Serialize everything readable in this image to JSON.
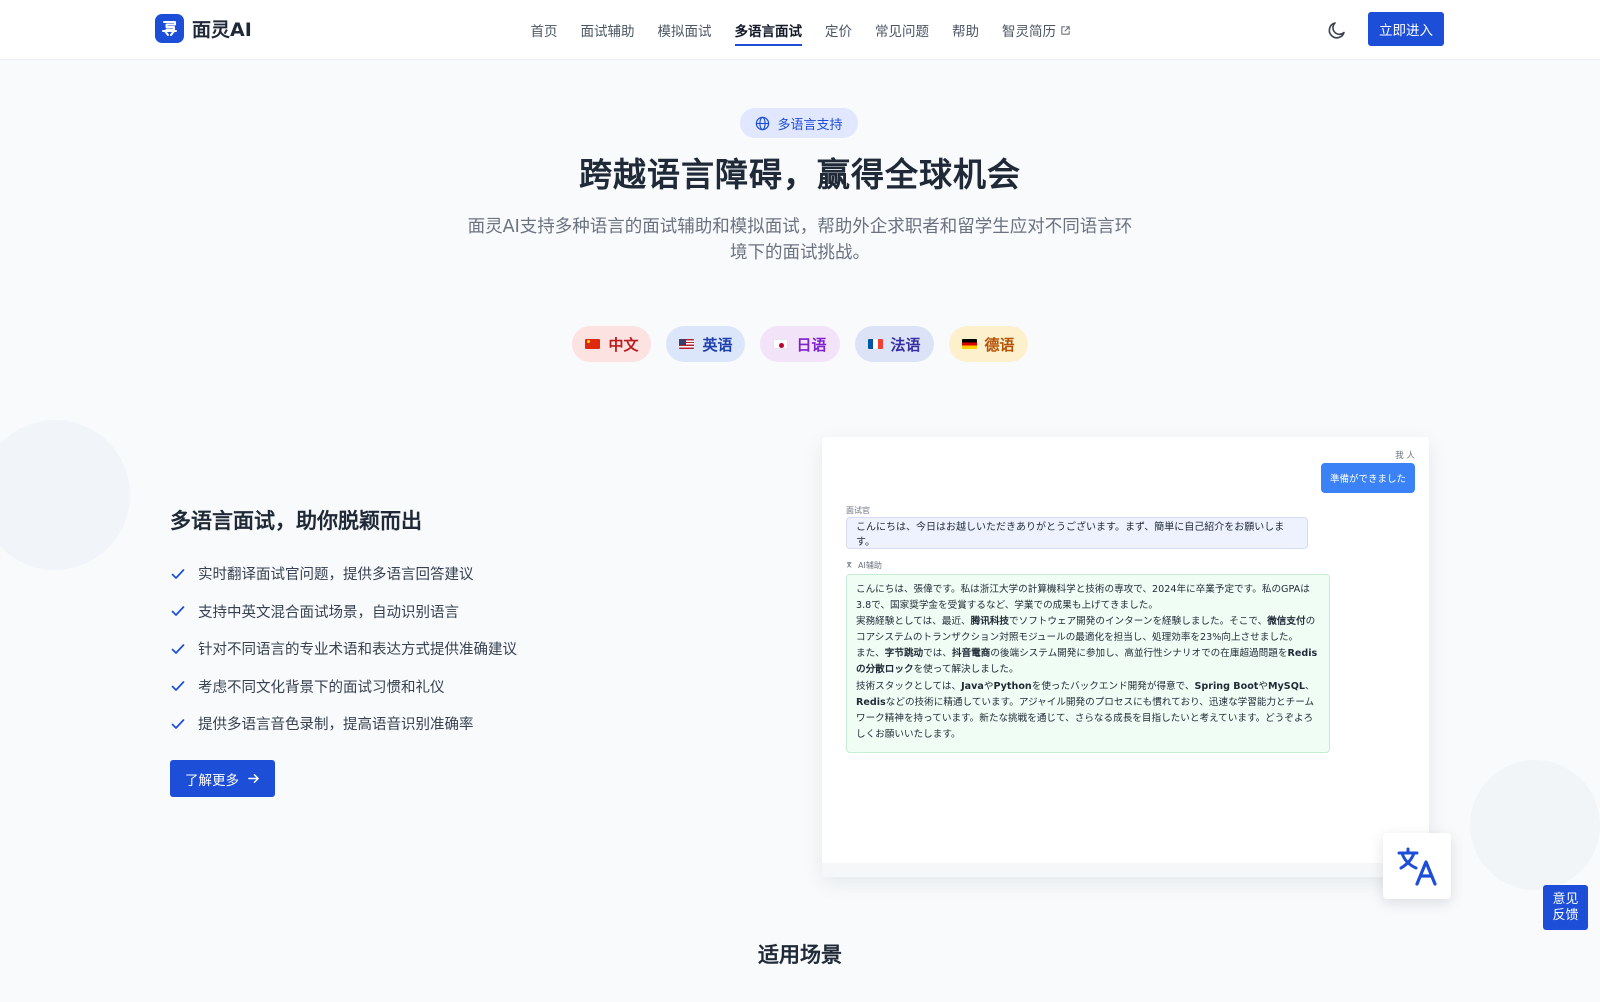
{
  "brand": {
    "name": "面灵AI"
  },
  "nav": {
    "items": [
      {
        "label": "首页",
        "active": false
      },
      {
        "label": "面试辅助",
        "active": false
      },
      {
        "label": "模拟面试",
        "active": false
      },
      {
        "label": "多语言面试",
        "active": true
      },
      {
        "label": "定价",
        "active": false
      },
      {
        "label": "常见问题",
        "active": false
      },
      {
        "label": "帮助",
        "active": false
      },
      {
        "label": "智灵简历",
        "active": false,
        "external": true
      }
    ],
    "cta_label": "立即进入",
    "theme_icon": "moon-icon"
  },
  "hero": {
    "badge": "多语言支持",
    "title": "跨越语言障碍，赢得全球机会",
    "subtitle": "面灵AI支持多种语言的面试辅助和模拟面试，帮助外企求职者和留学生应对不同语言环境下的面试挑战。"
  },
  "languages": [
    {
      "label": "中文",
      "flag": "cn-flag",
      "bg": "#fde2e2",
      "color": "#b91c1c"
    },
    {
      "label": "英语",
      "flag": "us-flag",
      "bg": "#dbe6fb",
      "color": "#1e40af"
    },
    {
      "label": "日语",
      "flag": "jp-flag",
      "bg": "#f3e3f9",
      "color": "#7e22ce"
    },
    {
      "label": "法语",
      "flag": "fr-flag",
      "bg": "#dde3f7",
      "color": "#3730a3"
    },
    {
      "label": "德语",
      "flag": "de-flag",
      "bg": "#fdf0cc",
      "color": "#b45309"
    }
  ],
  "feature": {
    "title": "多语言面试，助你脱颖而出",
    "items": [
      "实时翻译面试官问题，提供多语言回答建议",
      "支持中英文混合面试场景，自动识别语言",
      "针对不同语言的专业术语和表达方式提供准确建议",
      "考虑不同文化背景下的面试习惯和礼仪",
      "提供多语言音色录制，提高语音识别准确率"
    ],
    "button_label": "了解更多"
  },
  "chat": {
    "me_label": "我 人",
    "me_message": "準備ができました",
    "interviewer_label": "面试官",
    "interviewer_message": "こんにちは、今日はお越しいただきありがとうございます。まず、簡単に自己紹介をお願いします。",
    "ai_label": "AI辅助",
    "ai_lines": [
      [
        {
          "t": "こんにちは、張偉です。私は浙江大学の計算機科学と技術の専攻で、2024年に卒業予定です。私のGPAは3.8で、国家奨学金を受賞するなど、学業での成果も上げてきました。"
        }
      ],
      [
        {
          "t": "実務経験としては、最近、"
        },
        {
          "t": "腾讯科技",
          "b": true
        },
        {
          "t": "でソフトウェア開発のインターンを経験しました。そこで、"
        },
        {
          "t": "微信支付",
          "b": true
        },
        {
          "t": "のコアシステムのトランザクション対照モジュールの最適化を担当し、処理効率を23%向上させました。"
        }
      ],
      [
        {
          "t": "また、"
        },
        {
          "t": "字节跳动",
          "b": true
        },
        {
          "t": "では、"
        },
        {
          "t": "抖音電商",
          "b": true
        },
        {
          "t": "の後端システム開発に参加し、高並行性シナリオでの在庫超過問題を"
        },
        {
          "t": "Redisの分散ロック",
          "b": true
        },
        {
          "t": "を使って解決しました。"
        }
      ],
      [
        {
          "t": "技術スタックとしては、"
        },
        {
          "t": "Java",
          "b": true
        },
        {
          "t": "や"
        },
        {
          "t": "Python",
          "b": true
        },
        {
          "t": "を使ったバックエンド開発が得意で、"
        },
        {
          "t": "Spring Boot",
          "b": true
        },
        {
          "t": "や"
        },
        {
          "t": "MySQL",
          "b": true
        },
        {
          "t": "、"
        },
        {
          "t": "Redis",
          "b": true
        },
        {
          "t": "などの技術に精通しています。アジャイル開発のプロセスにも慣れており、迅速な学習能力とチームワーク精神を持っています。新たな挑戦を通じて、さらなる成長を目指したいと考えています。どうぞよろしくお願いいたします。"
        }
      ]
    ]
  },
  "fab_icon": "translate-icon",
  "feedback": {
    "line1": "意见",
    "line2": "反馈"
  },
  "scenes_title": "适用场景",
  "colors": {
    "primary": "#1d4ed8",
    "check": "#1d4ed8"
  }
}
